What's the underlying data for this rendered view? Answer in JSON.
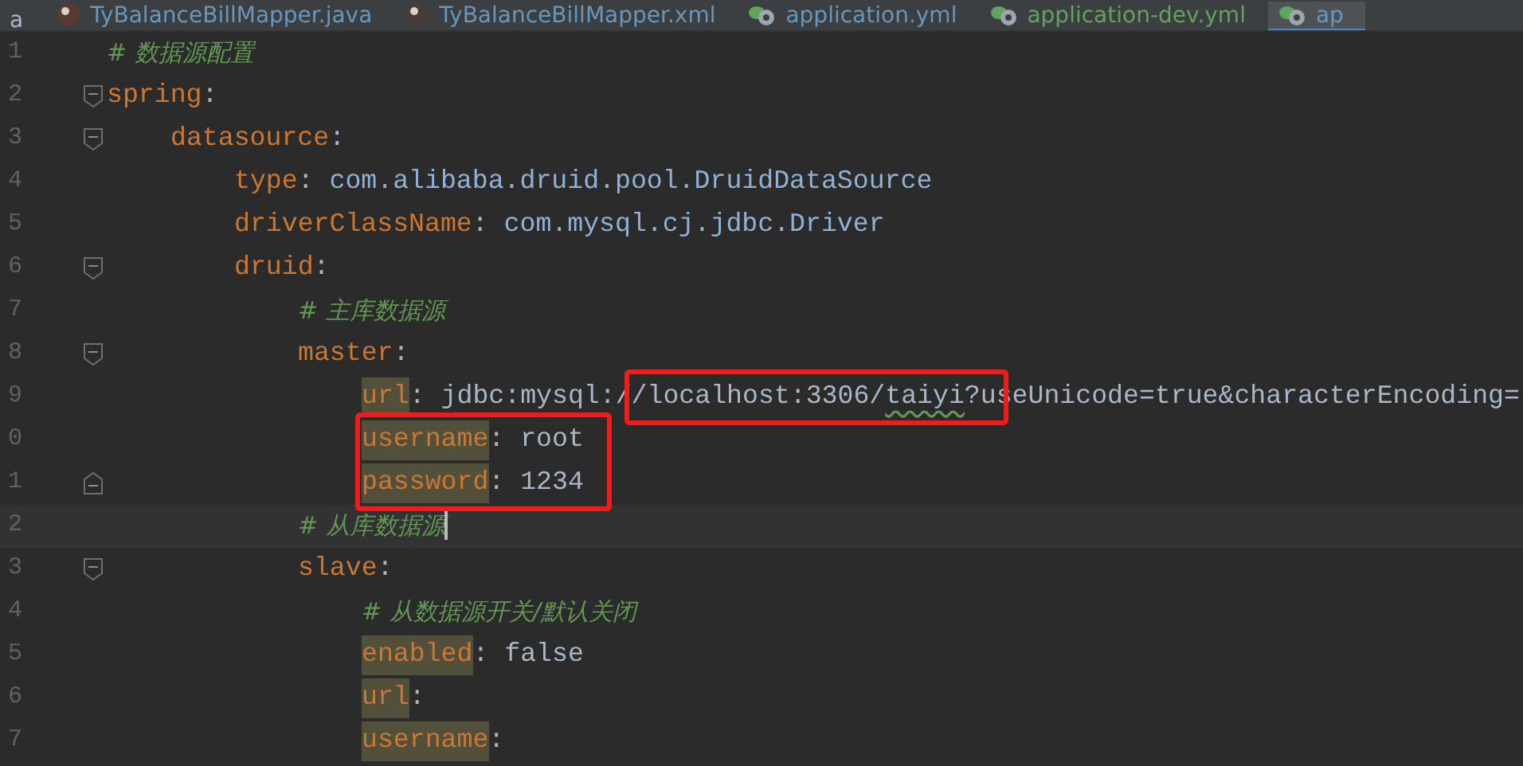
{
  "tabs": [
    {
      "label": "a",
      "kind": "plain",
      "color": "#a9b7c6",
      "selected": false
    },
    {
      "label": "TyBalanceBillMapper.java",
      "kind": "java",
      "color": "#6897bb",
      "selected": false
    },
    {
      "label": "TyBalanceBillMapper.xml",
      "kind": "xml",
      "color": "#6897bb",
      "selected": false
    },
    {
      "label": "application.yml",
      "kind": "yml",
      "color": "#6897bb",
      "selected": false
    },
    {
      "label": "application-dev.yml",
      "kind": "yml",
      "color": "#62a35c",
      "selected": false
    },
    {
      "label": "ap",
      "kind": "yml",
      "color": "#6897bb",
      "selected": true
    }
  ],
  "lines": [
    {
      "number": "1",
      "tokens": [
        {
          "kind": "comment",
          "text": "# 数据源配置"
        }
      ]
    },
    {
      "number": "2",
      "fold_start": true,
      "tokens": [
        {
          "kind": "key",
          "text": "spring"
        },
        {
          "kind": "punct",
          "text": ":"
        }
      ],
      "children": [
        {
          "number": "3",
          "fold_start": true,
          "tokens": [
            {
              "kind": "key",
              "text": "datasource"
            },
            {
              "kind": "punct",
              "text": ":"
            }
          ],
          "children": [
            {
              "number": "4",
              "tokens": [
                {
                  "kind": "key",
                  "text": "type"
                },
                {
                  "kind": "punct",
                  "text": ": "
                },
                {
                  "kind": "class",
                  "text": "com.alibaba.druid.pool.DruidDataSource"
                }
              ]
            },
            {
              "number": "5",
              "tokens": [
                {
                  "kind": "key",
                  "text": "driverClassName"
                },
                {
                  "kind": "punct",
                  "text": ": "
                },
                {
                  "kind": "class",
                  "text": "com.mysql.cj.jdbc.Driver"
                }
              ]
            },
            {
              "number": "6",
              "fold_start": true,
              "tokens": [
                {
                  "kind": "key",
                  "text": "druid"
                },
                {
                  "kind": "punct",
                  "text": ":"
                }
              ],
              "children": [
                {
                  "number": "7",
                  "tokens": [
                    {
                      "kind": "comment",
                      "text": "# 主库数据源"
                    }
                  ]
                },
                {
                  "number": "8",
                  "fold_start": true,
                  "tokens": [
                    {
                      "kind": "key",
                      "text": "master"
                    },
                    {
                      "kind": "punct",
                      "text": ":"
                    }
                  ],
                  "children": [
                    {
                      "number": "9",
                      "tokens": [
                        {
                          "kind": "key",
                          "text": "url",
                          "highlight": true
                        },
                        {
                          "kind": "punct",
                          "text": ": "
                        },
                        {
                          "kind": "value",
                          "text": "jdbc:mysql:/"
                        },
                        {
                          "kind": "value",
                          "text": "/localhost:3306/",
                          "framed": true
                        },
                        {
                          "kind": "value",
                          "text": "taiyi",
                          "framed": true,
                          "typo": true
                        },
                        {
                          "kind": "value",
                          "text": "?",
                          "framed": true
                        },
                        {
                          "kind": "value",
                          "text": "useUnicode=true&characterEncoding="
                        }
                      ]
                    },
                    {
                      "number": "0",
                      "tokens": [
                        {
                          "kind": "key",
                          "text": "username",
                          "highlight": true,
                          "framed": true
                        },
                        {
                          "kind": "punct",
                          "text": ": ",
                          "framed": true
                        },
                        {
                          "kind": "value",
                          "text": "root",
                          "framed": true
                        }
                      ]
                    },
                    {
                      "number": "1",
                      "fold_end": true,
                      "tokens": [
                        {
                          "kind": "key",
                          "text": "password",
                          "highlight": true,
                          "framed": true
                        },
                        {
                          "kind": "punct",
                          "text": ": ",
                          "framed": true
                        },
                        {
                          "kind": "value",
                          "text": "1234",
                          "framed": true
                        }
                      ]
                    }
                  ]
                },
                {
                  "number": "2",
                  "current": true,
                  "tokens": [
                    {
                      "kind": "comment",
                      "text": "# 从库数据源"
                    }
                  ]
                },
                {
                  "number": "3",
                  "fold_start": true,
                  "tokens": [
                    {
                      "kind": "key",
                      "text": "slave"
                    },
                    {
                      "kind": "punct",
                      "text": ":"
                    }
                  ],
                  "children": [
                    {
                      "number": "4",
                      "tokens": [
                        {
                          "kind": "comment",
                          "text": "# 从数据源开关/默认关闭"
                        }
                      ]
                    },
                    {
                      "number": "5",
                      "tokens": [
                        {
                          "kind": "key",
                          "text": "enabled",
                          "highlight": true
                        },
                        {
                          "kind": "punct",
                          "text": ": "
                        },
                        {
                          "kind": "value",
                          "text": "false"
                        }
                      ]
                    },
                    {
                      "number": "6",
                      "tokens": [
                        {
                          "kind": "key",
                          "text": "url",
                          "highlight": true
                        },
                        {
                          "kind": "punct",
                          "text": ":"
                        }
                      ]
                    },
                    {
                      "number": "7",
                      "tokens": [
                        {
                          "kind": "key",
                          "text": "username",
                          "highlight": true
                        },
                        {
                          "kind": "punct",
                          "text": ":"
                        }
                      ]
                    }
                  ]
                }
              ]
            }
          ]
        }
      ]
    }
  ]
}
